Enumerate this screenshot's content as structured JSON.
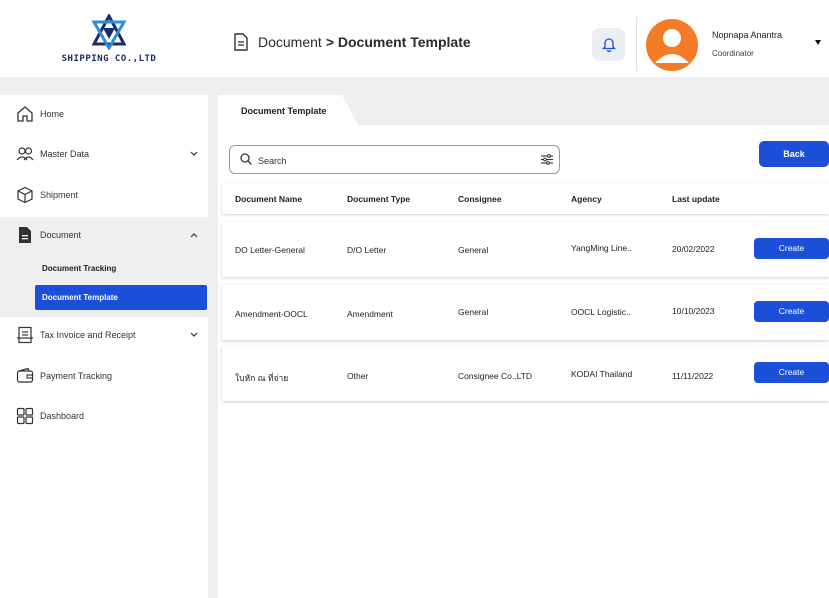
{
  "header": {
    "company_name": "SHIPPING CO.,LTD",
    "breadcrumb_parent": "Document",
    "breadcrumb_separator": ">",
    "breadcrumb_current": "Document Template",
    "user_name": "Nopnapa Anantra",
    "user_role": "Coordinator"
  },
  "sidebar": {
    "items": [
      {
        "label": "Home",
        "icon": "home-icon"
      },
      {
        "label": "Master Data",
        "icon": "users-icon"
      },
      {
        "label": "Shipment",
        "icon": "box-icon"
      },
      {
        "label": "Document",
        "icon": "document-icon"
      },
      {
        "label": "Tax Invoice and Receipt",
        "icon": "receipt-icon"
      },
      {
        "label": "Payment Tracking",
        "icon": "wallet-icon"
      },
      {
        "label": "Dashboard",
        "icon": "grid-icon"
      }
    ],
    "document_sub": [
      {
        "label": "Document Tracking"
      },
      {
        "label": "Document Template"
      }
    ]
  },
  "main": {
    "tab_label": "Document Template",
    "search_placeholder": "Search",
    "back_label": "Back",
    "columns": [
      "Document Name",
      "Document Type",
      "Consignee",
      "Agency",
      "Last update"
    ],
    "rows": [
      {
        "name": "DO Letter-General",
        "type": "D/O Letter",
        "consignee": "General",
        "agency": "YangMing Line..",
        "updated": "20/02/2022",
        "action": "Create"
      },
      {
        "name": "Amendment-OOCL",
        "type": "Amendment",
        "consignee": "General",
        "agency": "OOCL Logistic..",
        "updated": "10/10/2023",
        "action": "Create"
      },
      {
        "name": "ใบหัก ณ ที่จ่าย",
        "type": "Other",
        "consignee": "Consignee Co.,LTD",
        "agency": "KODAI Thailand",
        "updated": "11/11/2022",
        "action": "Create"
      }
    ]
  },
  "colors": {
    "primary": "#1b4fd8",
    "avatar": "#f57c26",
    "band": "#efeff1",
    "logo": "#1c2c6b"
  }
}
